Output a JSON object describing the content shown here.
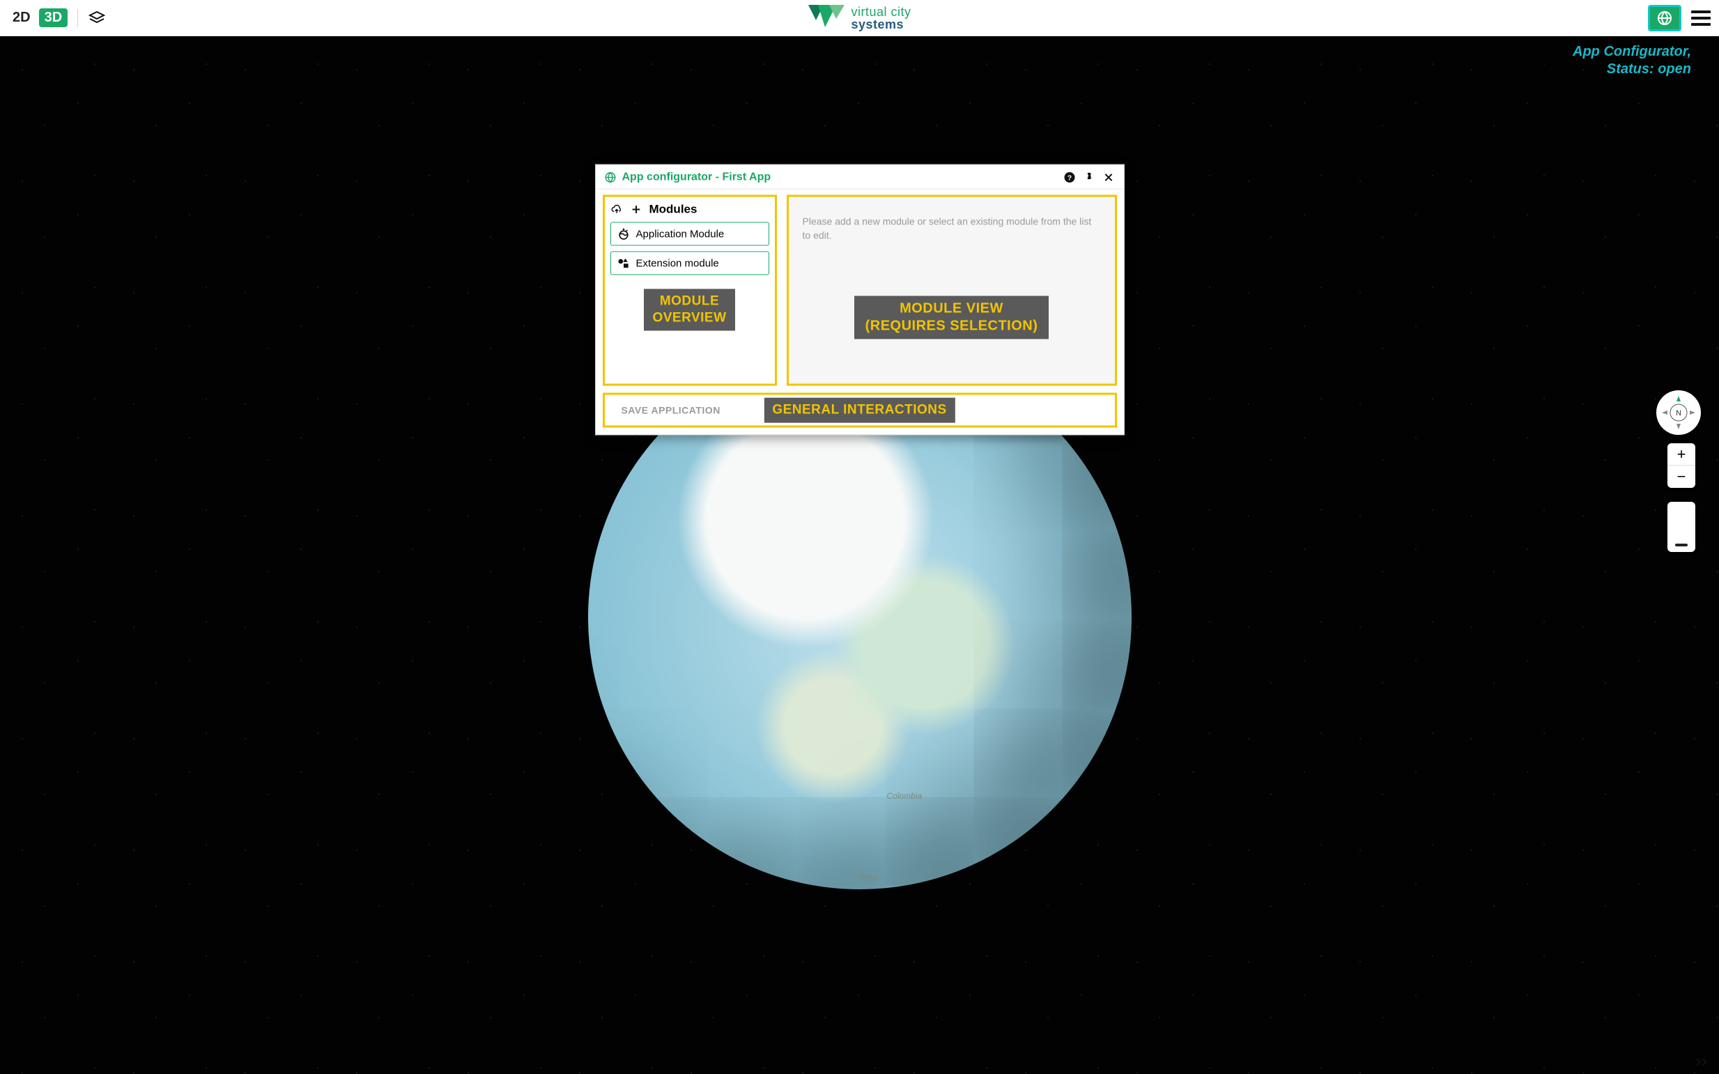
{
  "topbar": {
    "view2d": "2D",
    "view3d": "3D",
    "logo_line1": "virtual city",
    "logo_line2": "systems"
  },
  "tooltip": {
    "line1": "App Configurator,",
    "line2": "Status: open"
  },
  "panel": {
    "title": "App configurator - First App",
    "modules_header": "Modules",
    "modules": [
      {
        "label": "Application Module"
      },
      {
        "label": "Extension module"
      }
    ],
    "overview_label_l1": "MODULE",
    "overview_label_l2": "OVERVIEW",
    "view_label_l1": "MODULE VIEW",
    "view_label_l2": "(REQUIRES SELECTION)",
    "right_hint": "Please add a new module or select an existing module from the list to edit.",
    "save_button": "SAVE APPLICATION",
    "general_interactions_label": "GENERAL INTERACTIONS"
  },
  "compass_label": "N",
  "zoom_in": "+",
  "zoom_out": "−",
  "earth_labels": {
    "colombia": "Colombia",
    "peru": "Perú"
  }
}
